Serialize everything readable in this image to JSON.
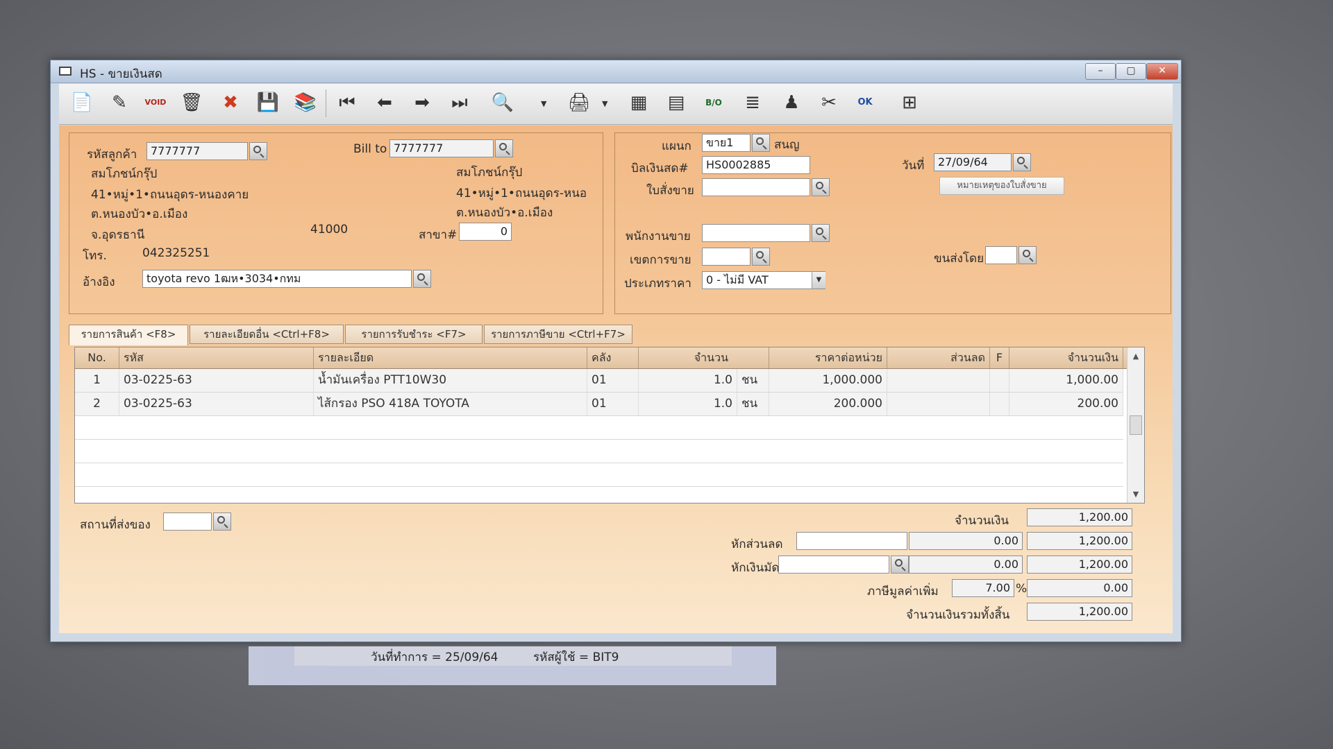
{
  "window": {
    "title": "HS - ขายเงินสด",
    "controls": {
      "minimize": "–",
      "maximize": "▢",
      "close": "✕"
    }
  },
  "toolbar": {
    "buttons": [
      {
        "name": "new-doc",
        "icon": "📄"
      },
      {
        "name": "edit",
        "icon": "✎"
      },
      {
        "name": "void",
        "icon": "VOID"
      },
      {
        "name": "delete",
        "icon": "🗑"
      },
      {
        "name": "cancel",
        "icon": "✖"
      },
      {
        "name": "save",
        "icon": "💾"
      },
      {
        "name": "books",
        "icon": "📚"
      },
      {
        "name": "first",
        "icon": "⏮"
      },
      {
        "name": "prev",
        "icon": "⬅"
      },
      {
        "name": "next",
        "icon": "➡"
      },
      {
        "name": "last",
        "icon": "⏭"
      },
      {
        "name": "find",
        "icon": "🔍"
      },
      {
        "name": "print",
        "icon": "🖨"
      },
      {
        "name": "calc",
        "icon": "▦"
      },
      {
        "name": "report",
        "icon": "▤"
      },
      {
        "name": "bo",
        "icon": "B/O"
      },
      {
        "name": "recal",
        "icon": "≣"
      },
      {
        "name": "approve",
        "icon": "♟"
      },
      {
        "name": "cut",
        "icon": "✂"
      },
      {
        "name": "ok",
        "icon": "OK"
      },
      {
        "name": "export",
        "icon": "⊞"
      }
    ]
  },
  "customer": {
    "code_label": "รหัสลูกค้า",
    "code": "7777777",
    "name": "สมโภชน์กรุ๊ป",
    "addr1": "41•หมู่•1•ถนนอุดร-หนองคาย",
    "addr2": "ต.หนองบัว•อ.เมือง",
    "province": "จ.อุดรธานี",
    "zip": "41000",
    "tel_label": "โทร.",
    "tel": "042325251",
    "ref_label": "อ้างอิง",
    "ref": "toyota revo 1ฒห•3034•กทม"
  },
  "billto": {
    "label": "Bill to",
    "code": "7777777",
    "name": "สมโภชน์กรุ๊ป",
    "addr1": "41•หมู่•1•ถนนอุดร-หนอ",
    "addr2": "ต.หนองบัว•อ.เมือง",
    "branch_label": "สาขา#",
    "branch": "0"
  },
  "doc": {
    "dept_label": "แผนก",
    "dept": "ขาย1",
    "dept_name": "สนญ",
    "bill_label": "บิลเงินสด#",
    "bill": "HS0002885",
    "date_label": "วันที่",
    "date": "27/09/64",
    "order_label": "ใบสั่งขาย",
    "order": "",
    "order_note_button": "หมายเหตุของใบสั่งขาย",
    "salesman_label": "พนักงานขาย",
    "salesman": "",
    "zone_label": "เขตการขาย",
    "zone": "",
    "ship_label": "ขนส่งโดย",
    "ship": "",
    "pricetype_label": "ประเภทราคา",
    "pricetype": "0 - ไม่มี VAT"
  },
  "tabs": [
    "รายการสินค้า <F8>",
    "รายละเอียดอื่น <Ctrl+F8>",
    "รายการรับชำระ <F7>",
    "รายการภาษีขาย <Ctrl+F7>"
  ],
  "grid": {
    "headers": {
      "no": "No.",
      "code": "รหัส",
      "desc": "รายละเอียด",
      "wh": "คลัง",
      "qty": "จำนวน",
      "price": "ราคาต่อหน่วย",
      "disc": "ส่วนลด",
      "f": "F",
      "amount": "จำนวนเงิน"
    },
    "rows": [
      {
        "no": "1",
        "code": "03-0225-63",
        "desc": "น้ำมันเครื่อง PTT10W30",
        "wh": "01",
        "qty": "1.0",
        "unit": "ชน",
        "price": "1,000.000",
        "disc": "",
        "f": "",
        "amount": "1,000.00"
      },
      {
        "no": "2",
        "code": "03-0225-63",
        "desc": "ไส้กรอง PSO 418A TOYOTA",
        "wh": "01",
        "qty": "1.0",
        "unit": "ชน",
        "price": "200.000",
        "disc": "",
        "f": "",
        "amount": "200.00"
      }
    ]
  },
  "footer": {
    "delivery_label": "สถานที่ส่งของ",
    "delivery": "",
    "amount_label": "จำนวนเงิน",
    "amount": "1,200.00",
    "discount_label": "หักส่วนลด",
    "discount_text": "",
    "discount_value": "0.00",
    "after_discount": "1,200.00",
    "deposit_label": "หักเงินมัดจำ",
    "deposit_text": "",
    "deposit_value": "0.00",
    "after_deposit": "1,200.00",
    "vat_label": "ภาษีมูลค่าเพิ่ม",
    "vat_rate": "7.00",
    "vat_pct": "%",
    "vat_amount": "0.00",
    "total_label": "จำนวนเงินรวมทั้งสิ้น",
    "total": "1,200.00"
  },
  "status": {
    "date_text": "วันที่ทำการ  =  25/09/64",
    "user_text": "รหัสผู้ใช้  =  BIT9"
  }
}
